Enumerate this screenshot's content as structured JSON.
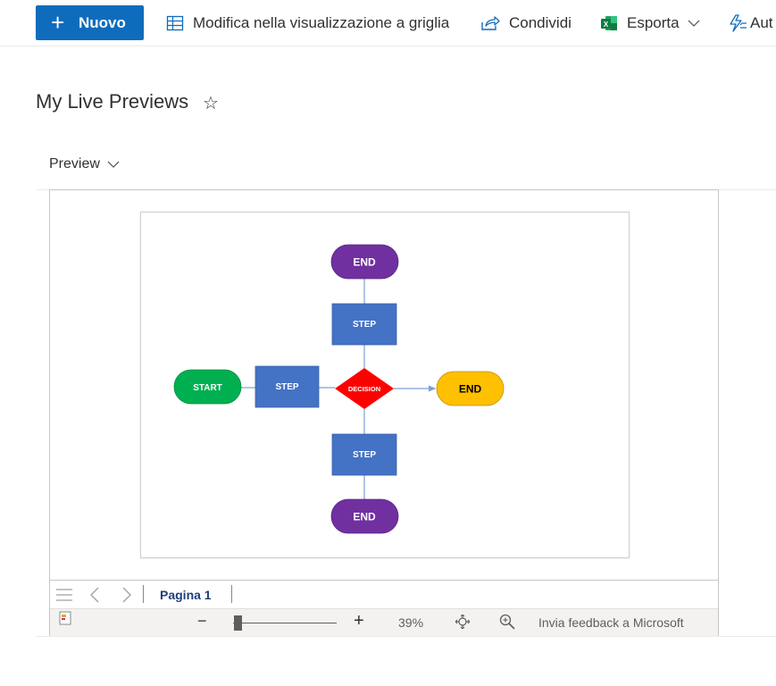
{
  "commandbar": {
    "new_label": "Nuovo",
    "grid_label": "Modifica nella visualizzazione a griglia",
    "share_label": "Condividi",
    "export_label": "Esporta",
    "automate_label": "Aut",
    "icons": [
      "plus-icon",
      "grid-icon",
      "share-icon",
      "excel-icon",
      "chevron-down-icon",
      "automate-icon"
    ],
    "colors": {
      "primary": "#0f6cbd",
      "excel": "#107c41"
    }
  },
  "page": {
    "title": "My Live Previews",
    "favorite_icon": "☆"
  },
  "preview": {
    "header_label": "Preview"
  },
  "diagram": {
    "nodes": [
      {
        "id": "end-top",
        "label": "END",
        "shape": "terminator",
        "fill": "#7030a0",
        "text": "#ffffff"
      },
      {
        "id": "step-top",
        "label": "STEP",
        "shape": "process",
        "fill": "#4472c4",
        "text": "#ffffff"
      },
      {
        "id": "start",
        "label": "START",
        "shape": "terminator",
        "fill": "#00b050",
        "text": "#ffffff"
      },
      {
        "id": "step-left",
        "label": "STEP",
        "shape": "process",
        "fill": "#4472c4",
        "text": "#ffffff"
      },
      {
        "id": "decision",
        "label": "DECISION",
        "shape": "decision",
        "fill": "#ff0000",
        "text": "#ffffff"
      },
      {
        "id": "end-right",
        "label": "END",
        "shape": "terminator",
        "fill": "#ffc000",
        "text": "#000000"
      },
      {
        "id": "step-bottom",
        "label": "STEP",
        "shape": "process",
        "fill": "#4472c4",
        "text": "#ffffff"
      },
      {
        "id": "end-bottom",
        "label": "END",
        "shape": "terminator",
        "fill": "#7030a0",
        "text": "#ffffff"
      }
    ],
    "connector_color": "#7f9fd6"
  },
  "viewer": {
    "page_label": "Pagina 1",
    "zoom": "39%",
    "feedback_label": "Invia feedback a Microsoft",
    "zoom_minus": "−",
    "zoom_plus": "+"
  }
}
